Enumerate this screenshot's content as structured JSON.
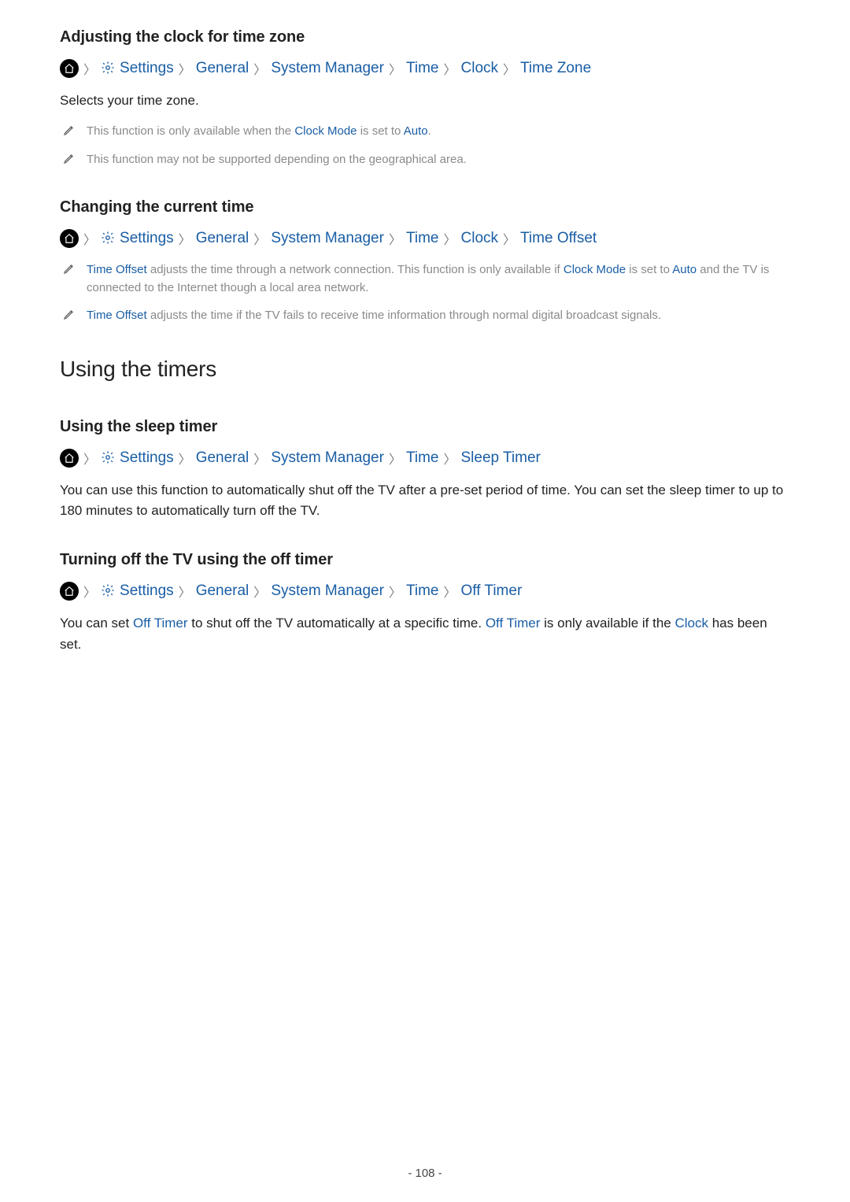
{
  "page_number": "- 108 -",
  "section1": {
    "title": "Adjusting the clock for time zone",
    "crumbs": [
      "Settings",
      "General",
      "System Manager",
      "Time",
      "Clock",
      "Time Zone"
    ],
    "body": "Selects your time zone.",
    "note1": {
      "pre": "This function is only available when the ",
      "l1": "Clock Mode",
      "mid": " is set to ",
      "l2": "Auto",
      "post": "."
    },
    "note2": "This function may not be supported depending on the geographical area."
  },
  "section2": {
    "title": "Changing the current time",
    "crumbs": [
      "Settings",
      "General",
      "System Manager",
      "Time",
      "Clock",
      "Time Offset"
    ],
    "note1": {
      "l1": "Time Offset",
      "pre": " adjusts the time through a network connection. This function is only available if ",
      "l2": "Clock Mode",
      "mid": " is set to ",
      "l3": "Auto",
      "post": " and the TV is connected to the Internet though a local area network."
    },
    "note2": {
      "l1": "Time Offset",
      "post": " adjusts the time if the TV fails to receive time information through normal digital broadcast signals."
    }
  },
  "main_heading": "Using the timers",
  "section3": {
    "title": "Using the sleep timer",
    "crumbs": [
      "Settings",
      "General",
      "System Manager",
      "Time",
      "Sleep Timer"
    ],
    "body": "You can use this function to automatically shut off the TV after a pre-set period of time. You can set the sleep timer to up to 180 minutes to automatically turn off the TV."
  },
  "section4": {
    "title": "Turning off the TV using the off timer",
    "crumbs": [
      "Settings",
      "General",
      "System Manager",
      "Time",
      "Off Timer"
    ],
    "body": {
      "pre": "You can set ",
      "l1": "Off Timer",
      "mid": " to shut off the TV automatically at a specific time. ",
      "l2": "Off Timer",
      "mid2": " is only available if the ",
      "l3": "Clock",
      "post": " has been set."
    }
  }
}
